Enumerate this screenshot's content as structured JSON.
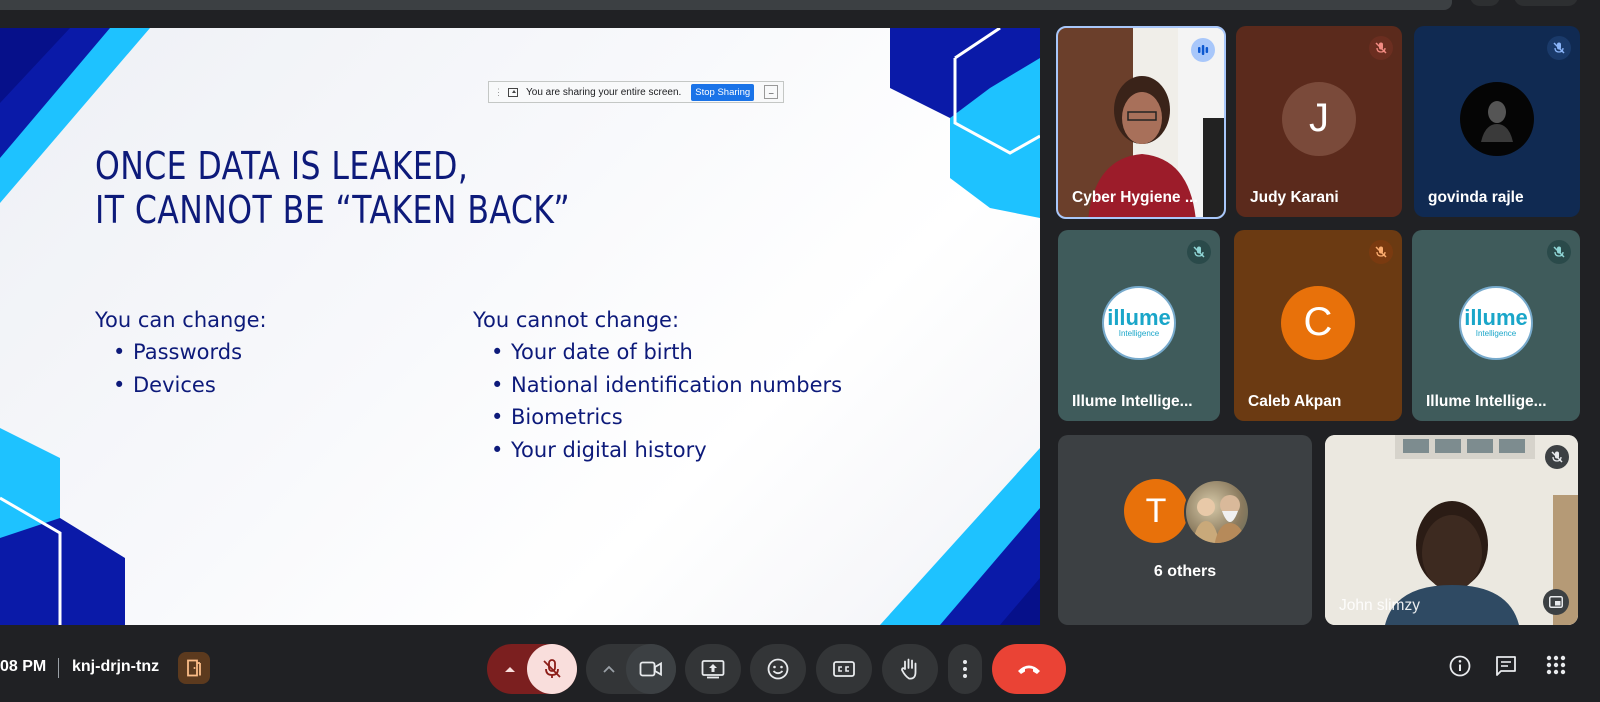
{
  "share_banner": {
    "text": "You are sharing your entire screen.",
    "stop_label": "Stop Sharing",
    "minimize_label": "_"
  },
  "slide": {
    "title_line1": "ONCE DATA IS LEAKED,",
    "title_line2": "IT CANNOT BE “TAKEN BACK”",
    "left_heading": "You can change:",
    "left_items": [
      "Passwords",
      "Devices"
    ],
    "right_heading": "You cannot change:",
    "right_items": [
      "Your date of birth",
      "National identification numbers",
      "Biometrics",
      "Your digital history"
    ]
  },
  "participants": [
    {
      "name": "Cyber Hygiene ...",
      "status": "speaking"
    },
    {
      "name": "Judy Karani",
      "initial": "J",
      "status": "muted"
    },
    {
      "name": "govinda rajle",
      "status": "muted"
    },
    {
      "name": "Illume Intellige...",
      "logo_text": "illume",
      "logo_sub": "Intelligence",
      "status": "muted"
    },
    {
      "name": "Caleb Akpan",
      "initial": "C",
      "status": "muted"
    },
    {
      "name": "Illume Intellige...",
      "logo_text": "illume",
      "logo_sub": "Intelligence",
      "status": "muted"
    },
    {
      "name": "John slimzy",
      "status": "muted"
    }
  ],
  "others": {
    "initial": "T",
    "label": "6 others"
  },
  "meeting": {
    "time": "08 PM",
    "code": "knj-drjn-tnz"
  },
  "colors": {
    "slide_text": "#0d1a7a",
    "leave_red": "#ea4335",
    "mic_off_bg": "#f9dedc",
    "avatar_orange": "#e8710a",
    "speaking_border": "#a8c7fa"
  },
  "icons": [
    "chevron-up-icon",
    "mic-off-icon",
    "camera-icon",
    "present-icon",
    "emoji-icon",
    "captions-icon",
    "raise-hand-icon",
    "more-vert-icon",
    "end-call-icon",
    "info-icon",
    "chat-icon",
    "apps-icon",
    "room-icon",
    "pip-icon"
  ]
}
